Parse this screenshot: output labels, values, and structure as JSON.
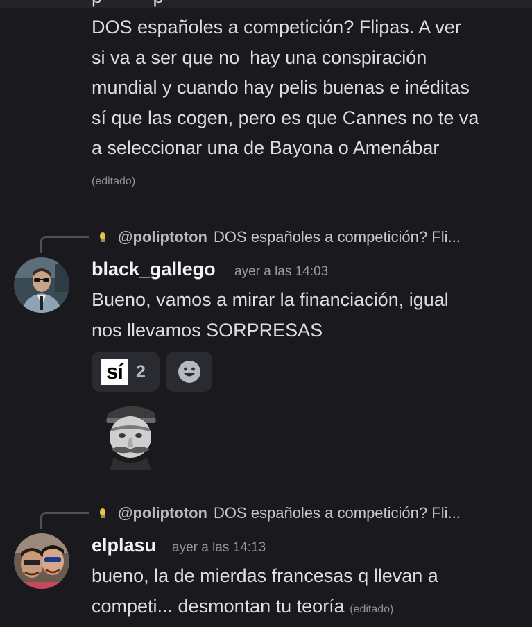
{
  "messages": [
    {
      "cut_text": "p · · · · p",
      "content": "DOS españoles a competición? Flipas. A ver\nsi va a ser que no  hay una conspiración\nmundial y cuando hay pelis buenas e inéditas\nsí que las cogen, pero es que Cannes no te va\na seleccionar una de Bayona o Amenábar",
      "edited": "(editado)"
    },
    {
      "reply_handle": "@poliptoton",
      "reply_snippet": "DOS españoles a competición? Fli...",
      "username": "black_gallego",
      "timestamp": "ayer a las 14:03",
      "content": "Bueno, vamos a mirar la financiación, igual\nnos llevamos SORPRESAS",
      "reactions": [
        {
          "emoji_text": "sí",
          "count": "2"
        },
        {
          "emoji_icon": "add-reaction-smiley-icon"
        }
      ],
      "sticker": "portrait-sticker"
    },
    {
      "reply_handle": "@poliptoton",
      "reply_snippet": "DOS españoles a competición? Fli...",
      "username": "elplasu",
      "timestamp": "ayer a las 14:13",
      "content_line1": "bueno, la de mierdas francesas q llevan a",
      "content_line2": "competi... desmontan tu teoría",
      "edited": "(editado)"
    }
  ],
  "colors": {
    "background": "#1a1a1e",
    "text": "#dbdee1",
    "username": "#f2f3f5",
    "muted": "#949ba4",
    "reaction_bg": "#2a2b30"
  }
}
